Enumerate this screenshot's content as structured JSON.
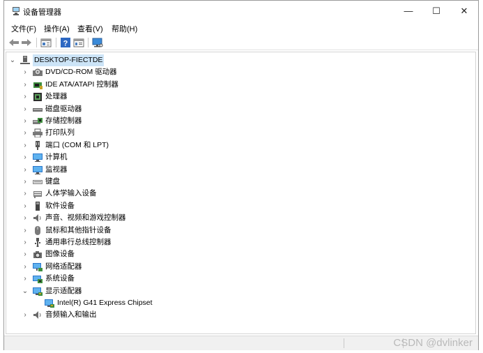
{
  "window": {
    "title": "设备管理器",
    "minimize_glyph": "—",
    "maximize_glyph": "☐",
    "close_glyph": "✕"
  },
  "menu": [
    {
      "label": "文件(F)"
    },
    {
      "label": "操作(A)"
    },
    {
      "label": "查看(V)"
    },
    {
      "label": "帮助(H)"
    }
  ],
  "tree": {
    "root": {
      "label": "DESKTOP-FIECTDE",
      "icon": "computer-tree-icon"
    },
    "categories": [
      {
        "label": "DVD/CD-ROM 驱动器",
        "icon": "dvd-drive-icon"
      },
      {
        "label": "IDE ATA/ATAPI 控制器",
        "icon": "ide-controller-icon"
      },
      {
        "label": "处理器",
        "icon": "processor-icon"
      },
      {
        "label": "磁盘驱动器",
        "icon": "disk-drive-icon"
      },
      {
        "label": "存储控制器",
        "icon": "storage-controller-icon"
      },
      {
        "label": "打印队列",
        "icon": "printer-icon"
      },
      {
        "label": "端口 (COM 和 LPT)",
        "icon": "port-icon"
      },
      {
        "label": "计算机",
        "icon": "computer-icon"
      },
      {
        "label": "监视器",
        "icon": "monitor-icon"
      },
      {
        "label": "键盘",
        "icon": "keyboard-icon"
      },
      {
        "label": "人体学输入设备",
        "icon": "hid-icon"
      },
      {
        "label": "软件设备",
        "icon": "software-device-icon"
      },
      {
        "label": "声音、视频和游戏控制器",
        "icon": "sound-icon"
      },
      {
        "label": "鼠标和其他指针设备",
        "icon": "mouse-icon"
      },
      {
        "label": "通用串行总线控制器",
        "icon": "usb-icon"
      },
      {
        "label": "图像设备",
        "icon": "camera-icon"
      },
      {
        "label": "网络适配器",
        "icon": "network-icon"
      },
      {
        "label": "系统设备",
        "icon": "system-device-icon"
      },
      {
        "label": "显示适配器",
        "icon": "display-adapter-icon",
        "expanded": true
      },
      {
        "label": "Intel(R) G41 Express Chipset",
        "icon": "display-adapter-icon",
        "child": true
      },
      {
        "label": "音频输入和输出",
        "icon": "audio-io-icon"
      }
    ]
  },
  "watermark": "CSDN @dvlinker"
}
